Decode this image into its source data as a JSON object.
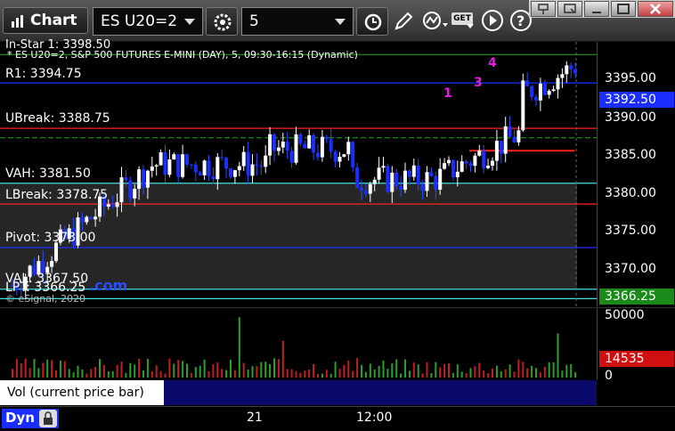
{
  "window": {
    "title": "Chart",
    "symbol": "ES U20=2",
    "interval": "5",
    "get_badge": "GET"
  },
  "chart": {
    "info_line": "* ES U20=2, S&P 500 FUTURES E-MINI (DAY), 5, 09:30-16:15 (Dynamic)",
    "top_partial": "In-Star 1: 3398.50",
    "copyright": "© eSignal, 2020",
    "levels": [
      {
        "label": "R1: 3394.75",
        "price": 3394.75,
        "color": "#1a2fff"
      },
      {
        "label": "UBreak: 3388.75",
        "price": 3388.75,
        "color": "#ff2020"
      },
      {
        "label": "VAH: 3381.50",
        "price": 3381.5,
        "color": "#40e0e0"
      },
      {
        "label": "LBreak: 3378.75",
        "price": 3378.75,
        "color": "#ff2020"
      },
      {
        "label": "Pivot: 3373.00",
        "price": 3373.0,
        "color": "#1a2fff"
      },
      {
        "label": "VAL: 3367.50",
        "price": 3367.5,
        "color": "#40e0e0"
      },
      {
        "label": "LPT: 3366.25",
        "price": 3366.25,
        "color": "#40e0e0"
      }
    ],
    "wave_labels": [
      "1",
      "3",
      "4"
    ],
    "watermark": ".com",
    "current_price": "3392.50",
    "lpt_tag": "3366.25"
  },
  "y_axis": {
    "ticks": [
      "3395.00",
      "3390.00",
      "3385.00",
      "3380.00",
      "3375.00",
      "3370.00"
    ]
  },
  "volume": {
    "ticks": [
      "50000",
      "0"
    ],
    "current": "14535",
    "legend": "Vol (current price bar)"
  },
  "x_axis": {
    "ticks": [
      "21",
      "12:00"
    ]
  },
  "footer": {
    "label": "Dyn"
  },
  "colors": {
    "up": "#ffffff",
    "down": "#1a2fff",
    "bg": "#000000"
  }
}
